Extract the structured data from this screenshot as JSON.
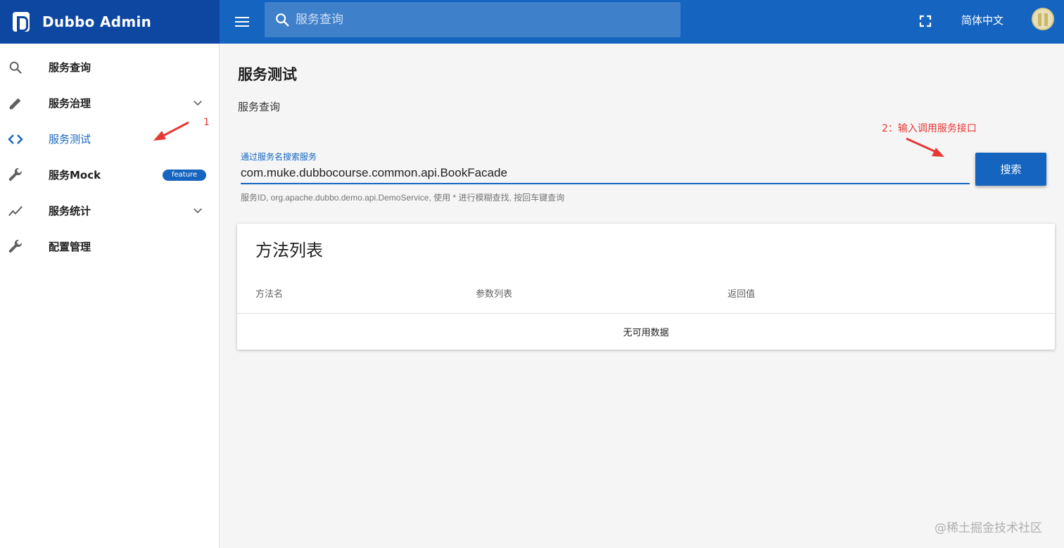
{
  "app": {
    "title": "Dubbo Admin",
    "accent": "#1565c0",
    "accent_dark": "#0d47a1",
    "annotation_color": "#e53935"
  },
  "header": {
    "search_placeholder": "服务查询",
    "language_label": "简体中文",
    "icons": [
      "menu-icon",
      "search-icon",
      "fullscreen-icon",
      "avatar"
    ]
  },
  "sidebar": {
    "items": [
      {
        "label": "服务查询",
        "icon": "search-icon",
        "expandable": false
      },
      {
        "label": "服务治理",
        "icon": "pencil-icon",
        "expandable": true
      },
      {
        "label": "服务测试",
        "icon": "code-icon",
        "expandable": false,
        "active": true
      },
      {
        "label": "服务Mock",
        "icon": "wrench-icon",
        "badge": "feature"
      },
      {
        "label": "服务统计",
        "icon": "chart-line-icon",
        "expandable": true
      },
      {
        "label": "配置管理",
        "icon": "wrench-icon",
        "expandable": false
      }
    ]
  },
  "main": {
    "page_title": "服务测试",
    "section_label": "服务查询",
    "search_field": {
      "label": "通过服务名搜索服务",
      "value": "com.muke.dubbocourse.common.api.BookFacade",
      "hint": "服务ID, org.apache.dubbo.demo.api.DemoService, 使用 * 进行模糊查找, 按回车键查询"
    },
    "search_button": "搜索",
    "method_table": {
      "title": "方法列表",
      "columns": [
        "方法名",
        "参数列表",
        "返回值"
      ],
      "empty_text": "无可用数据"
    }
  },
  "annotations": {
    "step1": "1",
    "step2": "2：输入调用服务接口"
  },
  "watermark": "@稀土掘金技术社区"
}
